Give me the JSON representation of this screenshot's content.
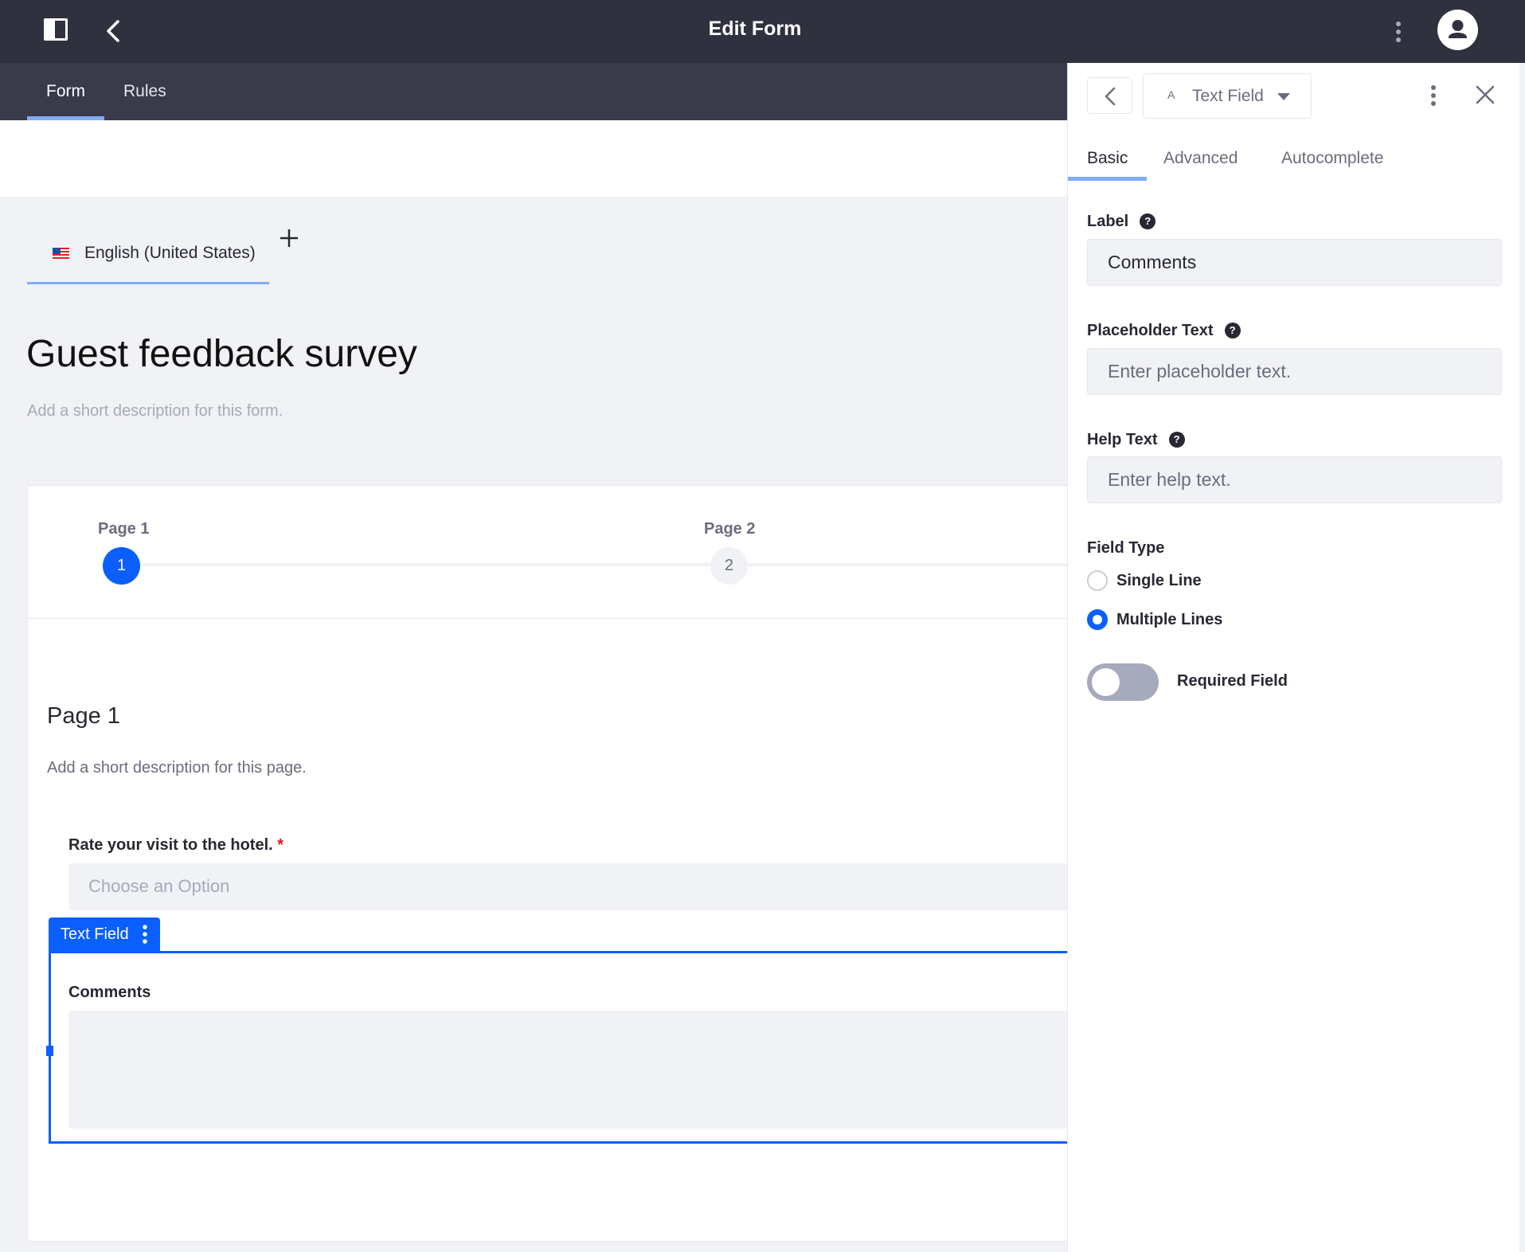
{
  "header": {
    "title": "Edit Form"
  },
  "tabs": {
    "form": "Form",
    "rules": "Rules"
  },
  "language": {
    "label": "English (United States)"
  },
  "form": {
    "title": "Guest feedback survey",
    "description_placeholder": "Add a short description for this form."
  },
  "pager": {
    "pages": [
      {
        "label": "Page 1",
        "number": "1"
      },
      {
        "label": "Page 2",
        "number": "2"
      }
    ]
  },
  "page": {
    "title": "Page 1",
    "description_placeholder": "Add a short description for this page."
  },
  "fields": {
    "rate": {
      "label": "Rate your visit to the hotel.",
      "required_mark": "*",
      "placeholder": "Choose an Option"
    },
    "selected_chip": "Text Field",
    "comments": {
      "label": "Comments"
    }
  },
  "sidebar": {
    "field_type": "Text Field",
    "type_icon": "A",
    "tabs": [
      "Basic",
      "Advanced",
      "Autocomplete"
    ],
    "label_title": "Label",
    "label_value": "Comments",
    "placeholder_title": "Placeholder Text",
    "placeholder_value": "Enter placeholder text.",
    "help_title": "Help Text",
    "help_value": "Enter help text.",
    "field_type_title": "Field Type",
    "options": [
      "Single Line",
      "Multiple Lines"
    ],
    "selected_option": "Multiple Lines",
    "required_label": "Required Field",
    "required_on": false
  },
  "colors": {
    "header_bg": "#30313f",
    "tabbar_bg": "#393a4a",
    "accent": "#0b5fff",
    "tab_underline": "#80acff"
  }
}
